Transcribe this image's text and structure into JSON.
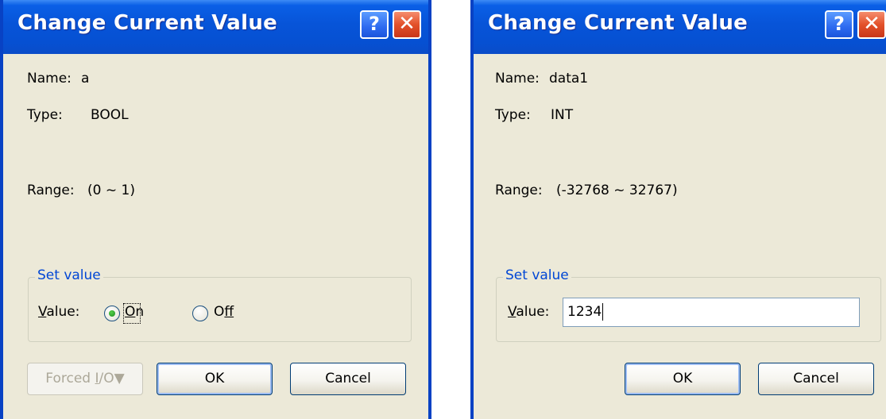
{
  "dialog_bool": {
    "title": "Change Current Value",
    "help_glyph": "?",
    "close_glyph": "✕",
    "name_label": "Name:",
    "name_value": "a",
    "type_label": "Type:",
    "type_value": "BOOL",
    "range_label": "Range:",
    "range_value": "(0 ~ 1)",
    "group_title": "Set value",
    "value_label_mnemonic": "V",
    "value_label_rest": "alue:",
    "radio_on": {
      "mnemonic": "O",
      "rest": "n",
      "selected": true
    },
    "radio_off": {
      "pre": "O",
      "mnemonic": "f",
      "rest": "f",
      "selected": false
    },
    "forced_button": {
      "pre": "Forced ",
      "mnemonic": "I",
      "rest": "/O",
      "arrow": "▼",
      "enabled": false
    },
    "ok_label": "OK",
    "cancel_label": "Cancel"
  },
  "dialog_int": {
    "title": "Change Current Value",
    "help_glyph": "?",
    "close_glyph": "✕",
    "name_label": "Name:",
    "name_value": "data1",
    "type_label": "Type:",
    "type_value": "INT",
    "range_label": "Range:",
    "range_value": "(-32768 ~ 32767)",
    "group_title": "Set value",
    "value_label_mnemonic": "V",
    "value_label_rest": "alue:",
    "value_input": "1234",
    "ok_label": "OK",
    "cancel_label": "Cancel"
  },
  "colors": {
    "titlebar": "#0754d8",
    "dialog_face": "#ece9d8",
    "group_title": "#0046d5",
    "close_button": "#e3512a",
    "radio_dot": "#1e8b21"
  },
  "icons": [
    "help-icon",
    "close-icon",
    "dropdown-arrow-icon"
  ]
}
